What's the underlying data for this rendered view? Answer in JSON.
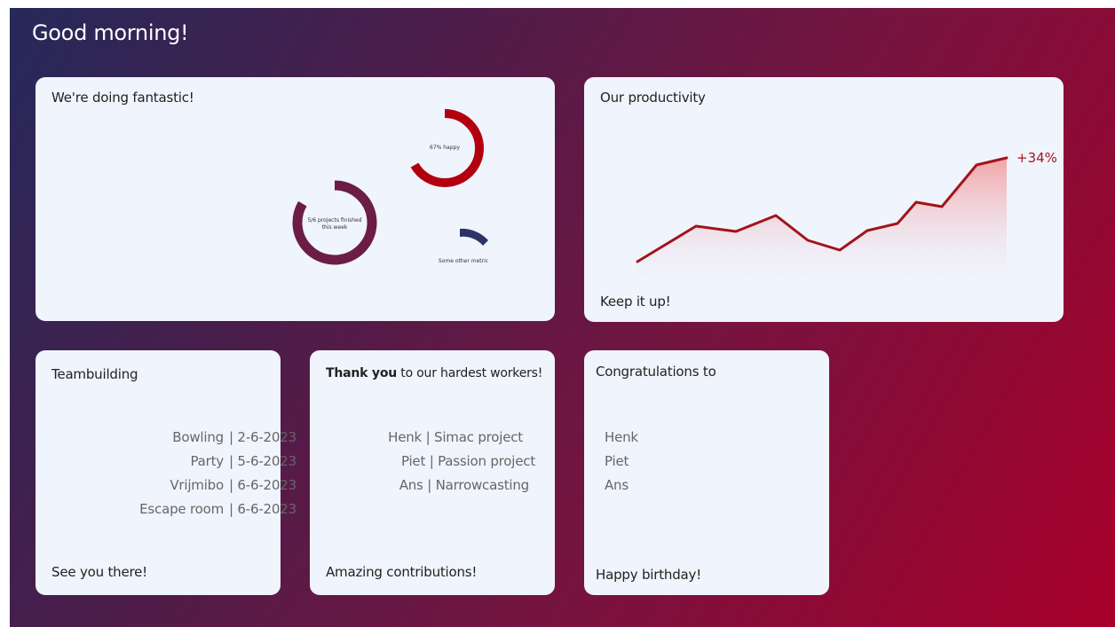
{
  "greeting": "Good morning!",
  "colors": {
    "card_bg": "#f0f4fd",
    "accent_red": "#b3000f",
    "accent_plum": "#6b1d45",
    "accent_navy": "#2b3565",
    "line_red": "#a3141b"
  },
  "status_card": {
    "title": "We're doing fantastic!",
    "metrics": [
      {
        "label": "67% happy",
        "fraction": 0.67,
        "color": "#b3000f"
      },
      {
        "label_line1": "5/6 projects finished",
        "label_line2": "this week",
        "fraction": 0.833,
        "color": "#6b1d45"
      },
      {
        "label": "Some other metric",
        "color": "#2b3565"
      }
    ]
  },
  "productivity_card": {
    "title": "Our productivity",
    "gain": "+34%",
    "footer": "Keep it up!"
  },
  "teambuilding_card": {
    "title": "Teambuilding",
    "events": [
      {
        "name": "Bowling",
        "date": "| 2-6-2023"
      },
      {
        "name": "Party",
        "date": "| 5-6-2023"
      },
      {
        "name": "Vrijmibo",
        "date": "| 6-6-2023"
      },
      {
        "name": "Escape room",
        "date": "| 6-6-2023"
      }
    ],
    "footer": "See you there!"
  },
  "thanks_card": {
    "title_strong": "Thank you",
    "title_rest": " to our hardest workers!",
    "workers": [
      "Henk | Simac project",
      "Piet | Passion project",
      "Ans | Narrowcasting"
    ],
    "footer": "Amazing contributions!"
  },
  "birthday_card": {
    "title": "Congratulations to",
    "names": [
      "Henk",
      "Piet",
      "Ans"
    ],
    "footer": "Happy birthday!"
  }
}
